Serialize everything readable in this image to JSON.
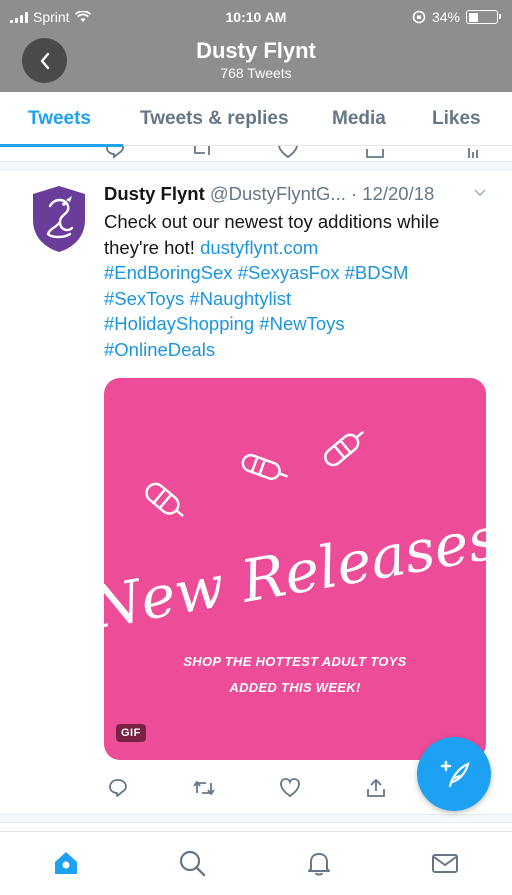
{
  "status_bar": {
    "carrier": "Sprint",
    "time": "10:10 AM",
    "battery": "34%"
  },
  "header": {
    "title": "Dusty Flynt",
    "subtitle": "768 Tweets"
  },
  "tabs": [
    {
      "label": "Tweets",
      "active": true
    },
    {
      "label": "Tweets & replies",
      "active": false
    },
    {
      "label": "Media",
      "active": false
    },
    {
      "label": "Likes",
      "active": false
    }
  ],
  "tweet": {
    "name": "Dusty Flynt",
    "handle": "@DustyFlyntG...",
    "date": "· 12/20/18",
    "text_lines": [
      "Check out our newest toy additions while",
      "they're hot! "
    ],
    "link": "dustyflynt.com",
    "hashtag_lines": [
      "#EndBoringSex #SexyasFox  #BDSM",
      "#SexToys #Naughtylist",
      "#HolidayShopping #NewToys",
      "#OnlineDeals"
    ],
    "media": {
      "headline": "New Releases",
      "promo_line1": "SHOP THE HOTTEST ADULT TOYS",
      "promo_line2": "ADDED THIS WEEK!",
      "badge": "GIF"
    }
  },
  "colors": {
    "accent": "#1da1f2",
    "header_bg": "#8e8e8e",
    "media_bg": "#ed4c98",
    "avatar_purple": "#6a3d9a"
  },
  "icons": {
    "reply": "comment-icon",
    "retweet": "retweet-icon",
    "like": "heart-icon",
    "share": "share-icon",
    "compose": "compose-feather-icon",
    "nav": [
      "home-icon",
      "search-icon",
      "notifications-icon",
      "messages-icon"
    ]
  }
}
